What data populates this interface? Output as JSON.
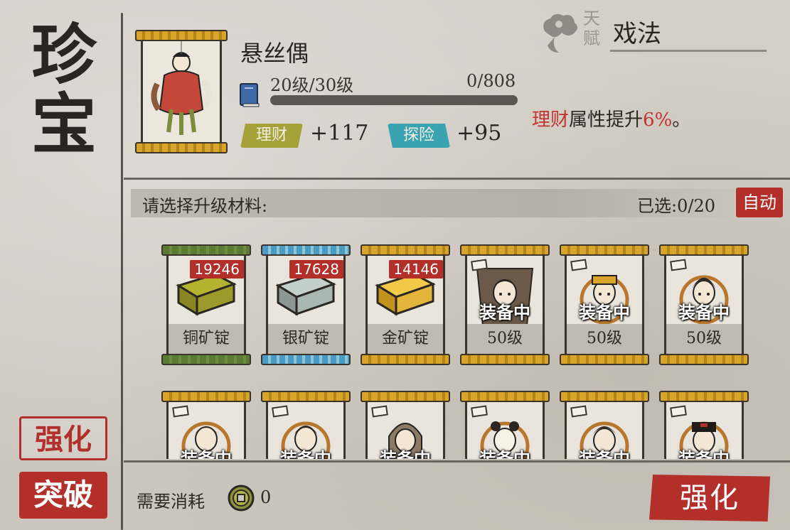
{
  "page_title": "珍宝",
  "side_buttons": {
    "strengthen": "强化",
    "breakthrough": "突破"
  },
  "item": {
    "name": "悬丝偶",
    "level": "20级/30级",
    "exp": "0/808",
    "exp_progress": 0,
    "stats": [
      {
        "label": "理财",
        "value": "+117",
        "color": "#a6a23a"
      },
      {
        "label": "探险",
        "value": "+95",
        "color": "#3aa3b2"
      }
    ]
  },
  "talent": {
    "label": "天赋",
    "name": "戏法",
    "desc_highlight": "理财",
    "desc_middle": "属性提升",
    "desc_percent": "6%",
    "desc_end": "。"
  },
  "materials": {
    "prompt": "请选择升级材料:",
    "selected": "已选:0/20",
    "auto_button": "自动",
    "cards": [
      {
        "type": "ingot",
        "name": "铜矿锭",
        "count": "19246",
        "rod": "green",
        "color": "#9c9a2a"
      },
      {
        "type": "ingot",
        "name": "银矿锭",
        "count": "17628",
        "rod": "blue",
        "color": "#a9b7b2"
      },
      {
        "type": "ingot",
        "name": "金矿锭",
        "count": "14146",
        "rod": "gold",
        "color": "#e3b53a"
      },
      {
        "type": "character",
        "status": "装备中",
        "level": "50级"
      },
      {
        "type": "character",
        "status": "装备中",
        "level": "50级"
      },
      {
        "type": "character",
        "status": "装备中",
        "level": "50级"
      },
      {
        "type": "character",
        "status": "装备中"
      },
      {
        "type": "character",
        "status": "装备中"
      },
      {
        "type": "character",
        "status": "装备中"
      },
      {
        "type": "character",
        "status": "装备中"
      },
      {
        "type": "character",
        "status": "装备中"
      },
      {
        "type": "character",
        "status": "装备中"
      }
    ]
  },
  "cost": {
    "label": "需要消耗",
    "icon": "coin-icon",
    "value": "0"
  },
  "main_button": "强化",
  "colors": {
    "accent_red": "#b22f2a",
    "highlight_red": "#c1342f"
  }
}
